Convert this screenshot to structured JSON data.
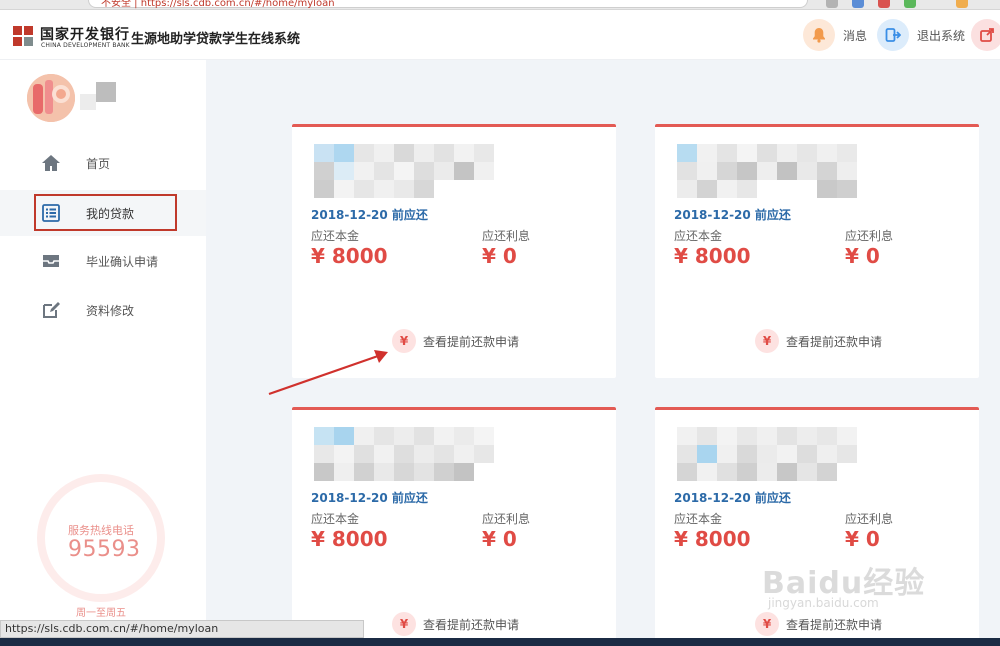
{
  "browser": {
    "url_fragment": "不安全 | https://sls.cdb.com.cn/#/home/myloan"
  },
  "header": {
    "bank_name_cn": "国家开发银行",
    "bank_name_en": "CHINA DEVELOPMENT BANK",
    "system_title": "生源地助学贷款学生在线系统",
    "messages_label": "消息",
    "logout_label": "退出系统"
  },
  "sidebar": {
    "items": [
      {
        "label": "首页",
        "icon": "home-icon"
      },
      {
        "label": "我的贷款",
        "icon": "list-icon"
      },
      {
        "label": "毕业确认申请",
        "icon": "inbox-icon"
      },
      {
        "label": "资料修改",
        "icon": "edit-icon"
      }
    ],
    "active_item": "我的贷款",
    "hotline_label": "服务热线电话",
    "hotline_number": "95593",
    "hotline_hours": "周一至周五"
  },
  "loans": [
    {
      "due": "2018-12-20 前应还",
      "principal_label": "应还本金",
      "principal": "¥ 8000",
      "interest_label": "应还利息",
      "interest": "¥ 0",
      "action": "查看提前还款申请"
    },
    {
      "due": "2018-12-20 前应还",
      "principal_label": "应还本金",
      "principal": "¥ 8000",
      "interest_label": "应还利息",
      "interest": "¥ 0",
      "action": "查看提前还款申请"
    },
    {
      "due": "2018-12-20 前应还",
      "principal_label": "应还本金",
      "principal": "¥ 8000",
      "interest_label": "应还利息",
      "interest": "¥ 0",
      "action": "查看提前还款申请"
    },
    {
      "due": "2018-12-20 前应还",
      "principal_label": "应还本金",
      "principal": "¥ 8000",
      "interest_label": "应还利息",
      "interest": "¥ 0",
      "action": "查看提前还款申请"
    }
  ],
  "prepay_icon_glyph": "¥",
  "status_bar_url": "https://sls.cdb.com.cn/#/home/myloan",
  "watermark": {
    "text": "Baidu经验",
    "sub": "jingyan.baidu.com"
  },
  "colors": {
    "accent_red": "#e04b45",
    "due_blue": "#2c6aa8",
    "highlight_border": "#c0392b"
  }
}
